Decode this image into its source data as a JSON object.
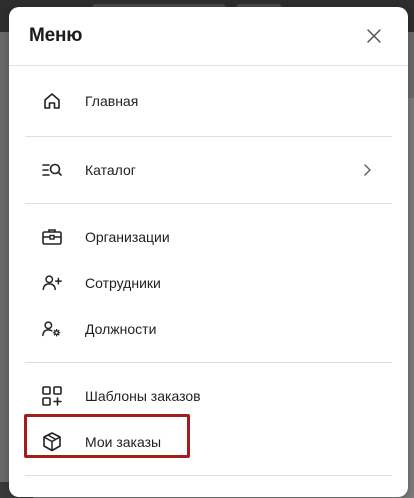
{
  "modal": {
    "title": "Меню",
    "close_icon": "close-icon"
  },
  "groups": [
    {
      "items": [
        {
          "label": "Главная",
          "icon": "home-icon"
        }
      ]
    },
    {
      "items": [
        {
          "label": "Каталог",
          "icon": "catalog-search-icon",
          "has_submenu": true
        }
      ]
    },
    {
      "items": [
        {
          "label": "Организации",
          "icon": "briefcase-icon"
        },
        {
          "label": "Сотрудники",
          "icon": "add-user-icon"
        },
        {
          "label": "Должности",
          "icon": "user-gear-icon"
        }
      ]
    },
    {
      "items": [
        {
          "label": "Шаблоны заказов",
          "icon": "grid-add-icon"
        },
        {
          "label": "Мои заказы",
          "icon": "package-icon",
          "highlighted": true
        }
      ]
    }
  ],
  "colors": {
    "highlight": "#a51c1c",
    "text": "#1f1f1f",
    "divider": "#dedede"
  }
}
